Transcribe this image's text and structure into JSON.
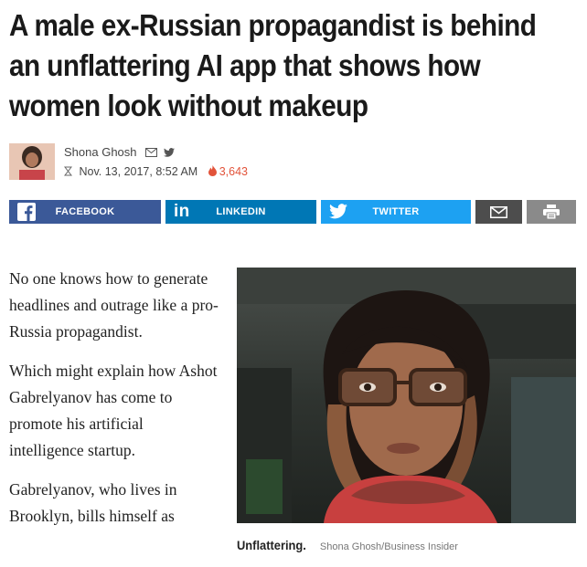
{
  "article": {
    "headline_lines": [
      "A male ex-Russian propagandist is behind",
      "an unflattering AI app that shows how",
      "women look without makeup"
    ],
    "author": "Shona Ghosh",
    "date": "Nov. 13, 2017, 8:52 AM",
    "views": "3,643"
  },
  "share": {
    "facebook": "FACEBOOK",
    "linkedin": "LINKEDIN",
    "twitter": "TWITTER"
  },
  "body": {
    "paragraphs": [
      "No one knows how to generate headlines and outrage like a pro-Russia propagandist.",
      "Which might explain how Ashot Gabrelyanov has come to promote his artificial intelligence startup.",
      "Gabrelyanov, who lives in Brooklyn, bills himself as"
    ]
  },
  "image": {
    "caption_title": "Unflattering.",
    "caption_credit": "Shona Ghosh/Business Insider"
  },
  "colors": {
    "facebook": "#3b5998",
    "linkedin": "#0077b5",
    "twitter": "#1da1f2",
    "email": "#4d4d4d",
    "print": "#8a8a8a",
    "views": "#e2533a"
  },
  "icons": [
    "mail-icon",
    "twitter-bird-icon",
    "clock-icon",
    "flame-icon",
    "facebook-icon",
    "linkedin-icon",
    "twitter-icon",
    "envelope-icon",
    "printer-icon"
  ]
}
